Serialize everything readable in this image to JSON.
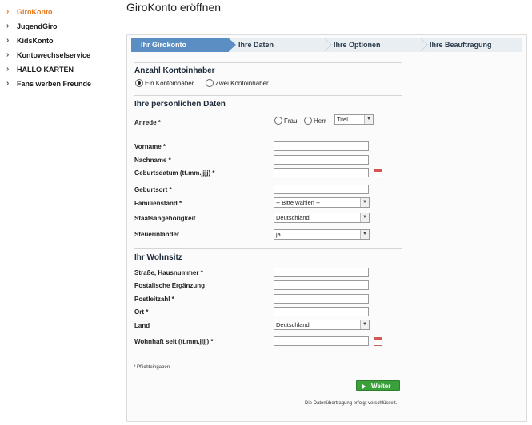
{
  "sidebar": {
    "items": [
      {
        "label": "GiroKonto"
      },
      {
        "label": "JugendGiro"
      },
      {
        "label": "KidsKonto"
      },
      {
        "label": "Kontowechselservice"
      },
      {
        "label": "HALLO KARTEN"
      },
      {
        "label": "Fans werben Freunde"
      }
    ]
  },
  "page": {
    "title": "GiroKonto eröffnen"
  },
  "steps": [
    {
      "label": "Ihr Girokonto"
    },
    {
      "label": "Ihre Daten"
    },
    {
      "label": "Ihre Optionen"
    },
    {
      "label": "Ihre Beauftragung"
    }
  ],
  "holders": {
    "title": "Anzahl Kontoinhaber",
    "option_one": "Ein Kontoinhaber",
    "option_two": "Zwei Kontoinhaber"
  },
  "personal": {
    "title": "Ihre persönlichen Daten",
    "anrede_label": "Anrede *",
    "frau_label": "Frau",
    "herr_label": "Herr",
    "titel_value": "Titel",
    "vorname_label": "Vorname *",
    "nachname_label": "Nachname *",
    "geburtsdatum_label": "Geburtsdatum (tt.mm.jjjj) *",
    "geburtsort_label": "Geburtsort *",
    "familienstand_label": "Familienstand *",
    "familienstand_value": "-- Bitte wählen --",
    "staat_label": "Staatsangehörigkeit",
    "staat_value": "Deutschland",
    "steuer_label": "Steuerinländer",
    "steuer_value": "ja"
  },
  "address": {
    "title": "Ihr Wohnsitz",
    "strasse_label": "Straße, Hausnummer *",
    "ergaenzung_label": "Postalische Ergänzung",
    "plz_label": "Postleitzahl *",
    "ort_label": "Ort *",
    "land_label": "Land",
    "land_value": "Deutschland",
    "wohnhaft_label": "Wohnhaft seit (tt.mm.jjjj) *"
  },
  "form": {
    "required_note": "* Pflichteingaben",
    "next_button": "Weiter",
    "secure_note": "Die Datenübertragung erfolgt verschlüsselt."
  }
}
